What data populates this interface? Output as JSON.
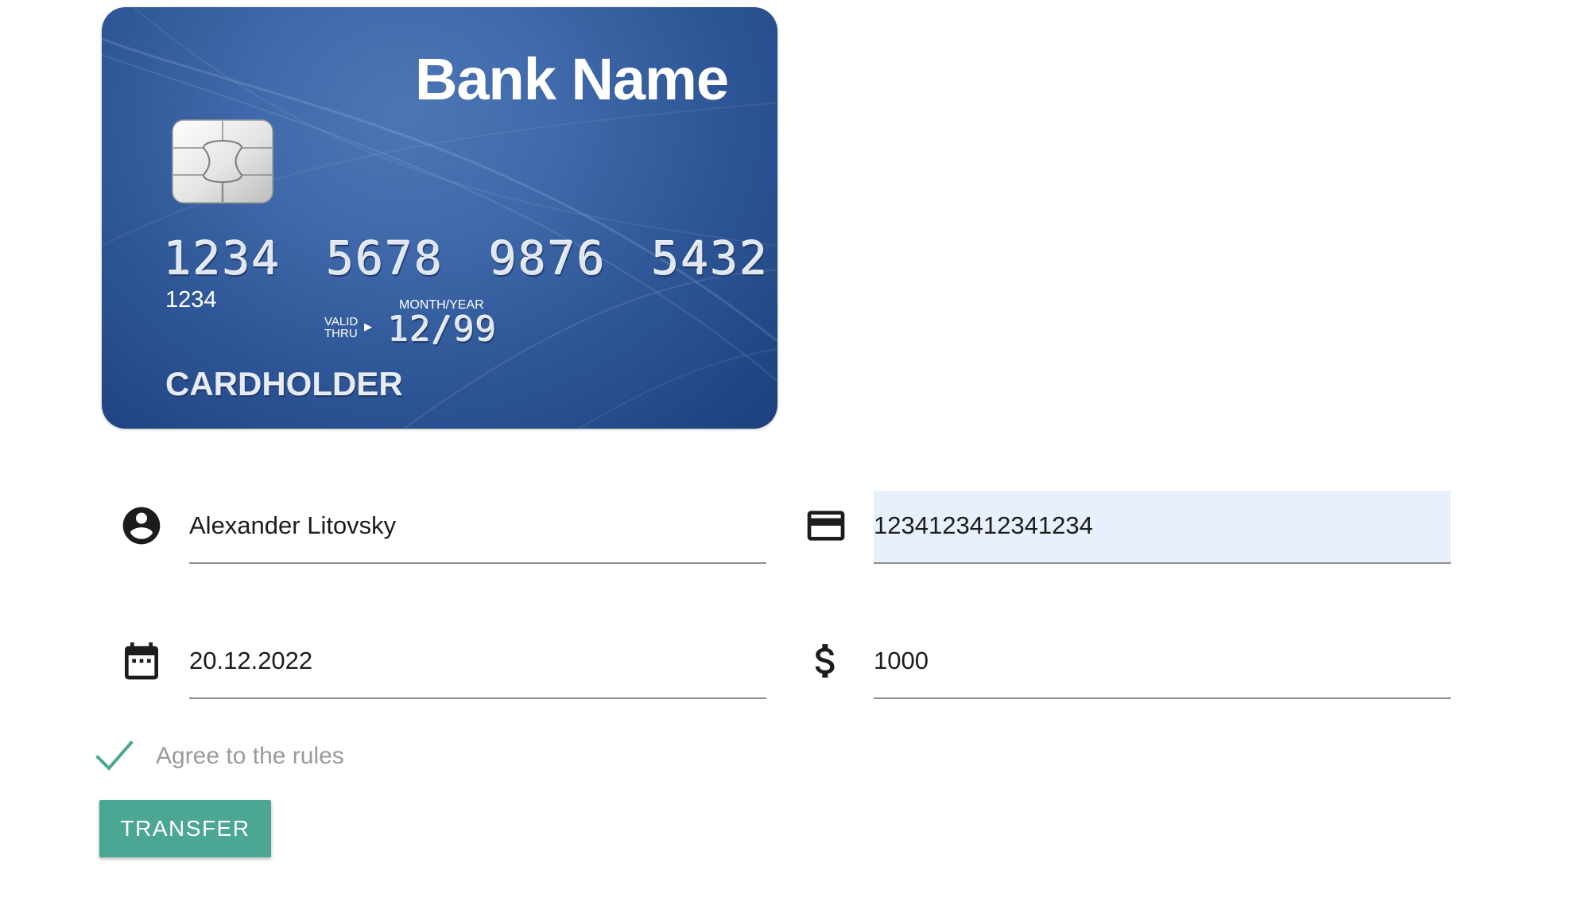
{
  "card": {
    "bank_name": "Bank Name",
    "number": "1234 5678 9876 5432",
    "small_number": "1234",
    "valid_thru_line1": "VALID",
    "valid_thru_line2": "THRU",
    "month_year_label": "MONTH/YEAR",
    "expiry": "12/99",
    "cardholder": "CARDHOLDER",
    "colors": {
      "card_gradient_light": "#4d76b6",
      "card_gradient_dark": "#1d3f7d"
    }
  },
  "form": {
    "name_field": {
      "value": "Alexander Litovsky",
      "icon": "account-circle-icon"
    },
    "card_number_field": {
      "value": "1234123412341234",
      "icon": "credit-card-icon"
    },
    "date_field": {
      "value": "20.12.2022",
      "icon": "calendar-icon"
    },
    "amount_field": {
      "value": "1000",
      "icon": "dollar-icon"
    },
    "agree_checkbox": {
      "label": "Agree to the rules",
      "checked": true
    },
    "transfer_button": {
      "label": "TRANSFER"
    }
  },
  "colors": {
    "accent": "#4ca694",
    "autofill_background": "#e8f0fe",
    "underline": "#8e8e8e",
    "checkbox_label": "#9a9a9a"
  }
}
